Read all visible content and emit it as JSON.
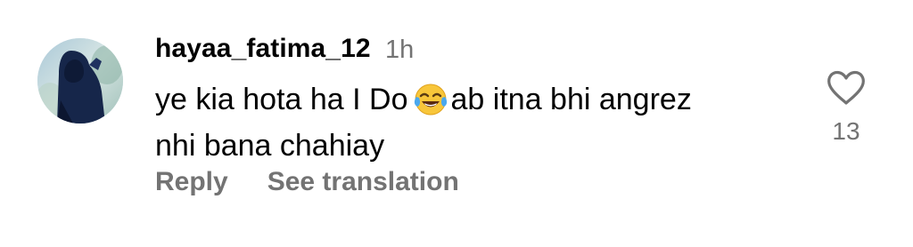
{
  "comment": {
    "username": "hayaa_fatima_12",
    "timestamp": "1h",
    "text_line1_before_emoji": "ye kia hota ha I Do",
    "text_line1_after_emoji": "ab itna bhi angrez",
    "text_line2": "nhi bana chahiay",
    "emoji": "face-with-tears-of-joy",
    "like_count": "13",
    "like_icon": "heart-outline-icon"
  },
  "actions": {
    "reply_label": "Reply",
    "translate_label": "See translation"
  },
  "colors": {
    "text_primary": "#000000",
    "text_secondary": "#737373",
    "background": "#ffffff"
  }
}
